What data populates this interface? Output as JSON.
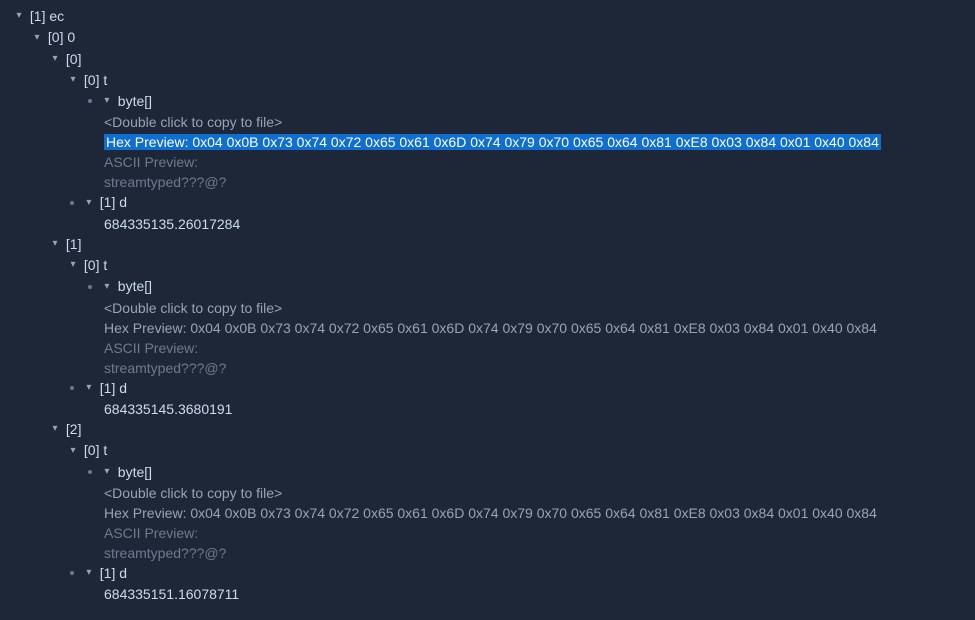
{
  "root": {
    "label": "[1] ec"
  },
  "node_0": {
    "label": "[0] 0"
  },
  "groups": [
    {
      "idx_label": "[0]",
      "t_label": "[0] t",
      "byte_label": "byte[]",
      "copy_hint": "<Double click to copy to file>",
      "hex_prefix": "Hex Preview: ",
      "hex_value": "0x04 0x0B 0x73 0x74 0x72 0x65 0x61 0x6D 0x74 0x79 0x70 0x65 0x64 0x81 0xE8 0x03 0x84 0x01 0x40 0x84",
      "hex_highlighted": true,
      "ascii_label": "ASCII Preview:",
      "ascii_value": "streamtyped???@?",
      "d_label": "[1] d",
      "d_value": "684335135.26017284"
    },
    {
      "idx_label": "[1]",
      "t_label": "[0] t",
      "byte_label": "byte[]",
      "copy_hint": "<Double click to copy to file>",
      "hex_prefix": "Hex Preview: ",
      "hex_value": "0x04 0x0B 0x73 0x74 0x72 0x65 0x61 0x6D 0x74 0x79 0x70 0x65 0x64 0x81 0xE8 0x03 0x84 0x01 0x40 0x84",
      "hex_highlighted": false,
      "ascii_label": "ASCII Preview:",
      "ascii_value": "streamtyped???@?",
      "d_label": "[1] d",
      "d_value": "684335145.3680191"
    },
    {
      "idx_label": "[2]",
      "t_label": "[0] t",
      "byte_label": "byte[]",
      "copy_hint": "<Double click to copy to file>",
      "hex_prefix": "Hex Preview: ",
      "hex_value": "0x04 0x0B 0x73 0x74 0x72 0x65 0x61 0x6D 0x74 0x79 0x70 0x65 0x64 0x81 0xE8 0x03 0x84 0x01 0x40 0x84",
      "hex_highlighted": false,
      "ascii_label": "ASCII Preview:",
      "ascii_value": "streamtyped???@?",
      "d_label": "[1] d",
      "d_value": "684335151.16078711"
    }
  ]
}
